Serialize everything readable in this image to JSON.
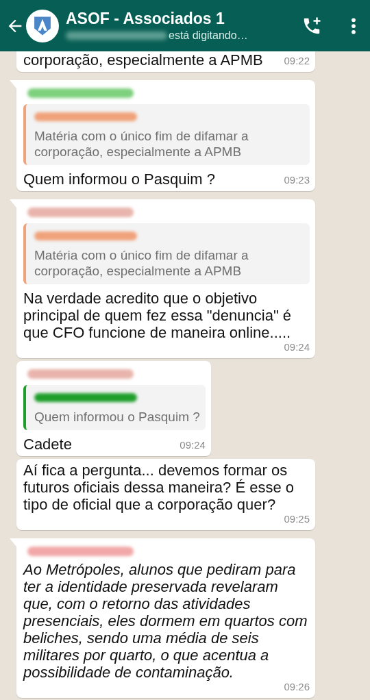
{
  "header": {
    "title": "ASOF - Associados 1",
    "status": "está digitando…"
  },
  "messages": [
    {
      "kind": "cut",
      "tail": false,
      "italic": false,
      "text": "corporação, especialmente a APMB",
      "time": "09:22"
    },
    {
      "kind": "reply",
      "tail": true,
      "color": "#7ed07e",
      "quote": {
        "color": "#f0a27a",
        "text": "Matéria com o único fim de difamar a corporação, especialmente a APMB"
      },
      "italic": false,
      "text": "Quem informou o Pasquim ?",
      "time": "09:23"
    },
    {
      "kind": "reply",
      "tail": true,
      "color": "#e8b4ac",
      "quote": {
        "color": "#f0a27a",
        "text": "Matéria com o único fim de difamar a corporação, especialmente a APMB"
      },
      "italic": false,
      "text": "Na verdade acredito que o objetivo principal de quem fez essa \"denuncia\" é que CFO funcione de maneira online.....",
      "time": "09:24"
    },
    {
      "kind": "reply",
      "tail": false,
      "color": "#e8b4ac",
      "quote": {
        "color": "#1f9e2b",
        "text": "Quem informou o Pasquim ?"
      },
      "italic": false,
      "text": "Cadete",
      "time": "09:24"
    },
    {
      "kind": "plain",
      "tail": false,
      "italic": false,
      "text": "Aí fica a pergunta... devemos formar os futuros oficiais dessa maneira? É esse o tipo de oficial que a corporação quer?",
      "time": "09:25"
    },
    {
      "kind": "plain",
      "tail": true,
      "color": "#f2a8a8",
      "italic": true,
      "text": "Ao Metrópoles, alunos que pediram para ter a identidade preservada revelaram que, com o retorno das atividades presenciais, eles dormem em quartos com beliches, sendo uma média de seis militares por quarto, o que acentua a possibilidade de contaminação.",
      "time": "09:26"
    }
  ]
}
